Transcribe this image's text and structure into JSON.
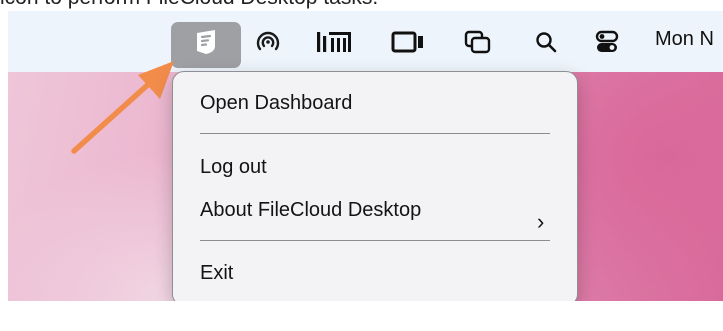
{
  "caption": "icon to perform FileCloud Desktop tasks.",
  "menubar": {
    "icons": [
      {
        "name": "filecloud-icon"
      },
      {
        "name": "airdrop-icon"
      },
      {
        "name": "stats-icon"
      },
      {
        "name": "screen-record-icon"
      },
      {
        "name": "window-switch-icon"
      },
      {
        "name": "search-icon"
      },
      {
        "name": "control-center-icon"
      }
    ],
    "clock": "Mon N"
  },
  "menu": {
    "items": [
      {
        "label": "Open Dashboard"
      },
      {
        "label": "Log out"
      },
      {
        "label": "About FileCloud Desktop",
        "has_submenu": true
      },
      {
        "label": "Exit"
      }
    ],
    "submenu_chevron": "›"
  },
  "colors": {
    "arrow": "#f28c4b",
    "menubar": "#eef4fc",
    "menu_bg": "#f3f3f5",
    "active_icon_bg": "#9ea0a4"
  }
}
